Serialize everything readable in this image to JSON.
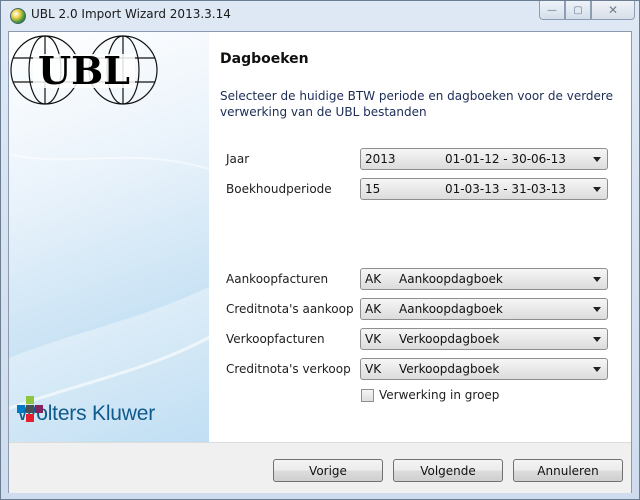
{
  "window": {
    "title": "UBL 2.0 Import Wizard 2013.3.14",
    "minimize_glyph": "—",
    "maximize_glyph": "▢",
    "close_glyph": "✕"
  },
  "sidebar": {
    "logo_text": "UBL",
    "brand": "Wolters Kluwer"
  },
  "page": {
    "heading": "Dagboeken",
    "intro": "Selecteer de huidige BTW periode en dagboeken voor de verdere verwerking van de UBL bestanden"
  },
  "fields": {
    "jaar": {
      "label": "Jaar",
      "code": "2013",
      "value": "01-01-12 - 30-06-13"
    },
    "periode": {
      "label": "Boekhoudperiode",
      "code": "15",
      "value": "01-03-13 - 31-03-13"
    },
    "aankoop": {
      "label": "Aankoopfacturen",
      "code": "AK",
      "value": "Aankoopdagboek"
    },
    "credit_aankoop": {
      "label": "Creditnota's aankoop",
      "code": "AK",
      "value": "Aankoopdagboek"
    },
    "verkoop": {
      "label": "Verkoopfacturen",
      "code": "VK",
      "value": "Verkoopdagboek"
    },
    "credit_verkoop": {
      "label": "Creditnota's verkoop",
      "code": "VK",
      "value": "Verkoopdagboek"
    }
  },
  "checkbox": {
    "label": "Verwerking in groep",
    "checked": false
  },
  "buttons": {
    "back": "Vorige",
    "next": "Volgende",
    "cancel": "Annuleren"
  }
}
